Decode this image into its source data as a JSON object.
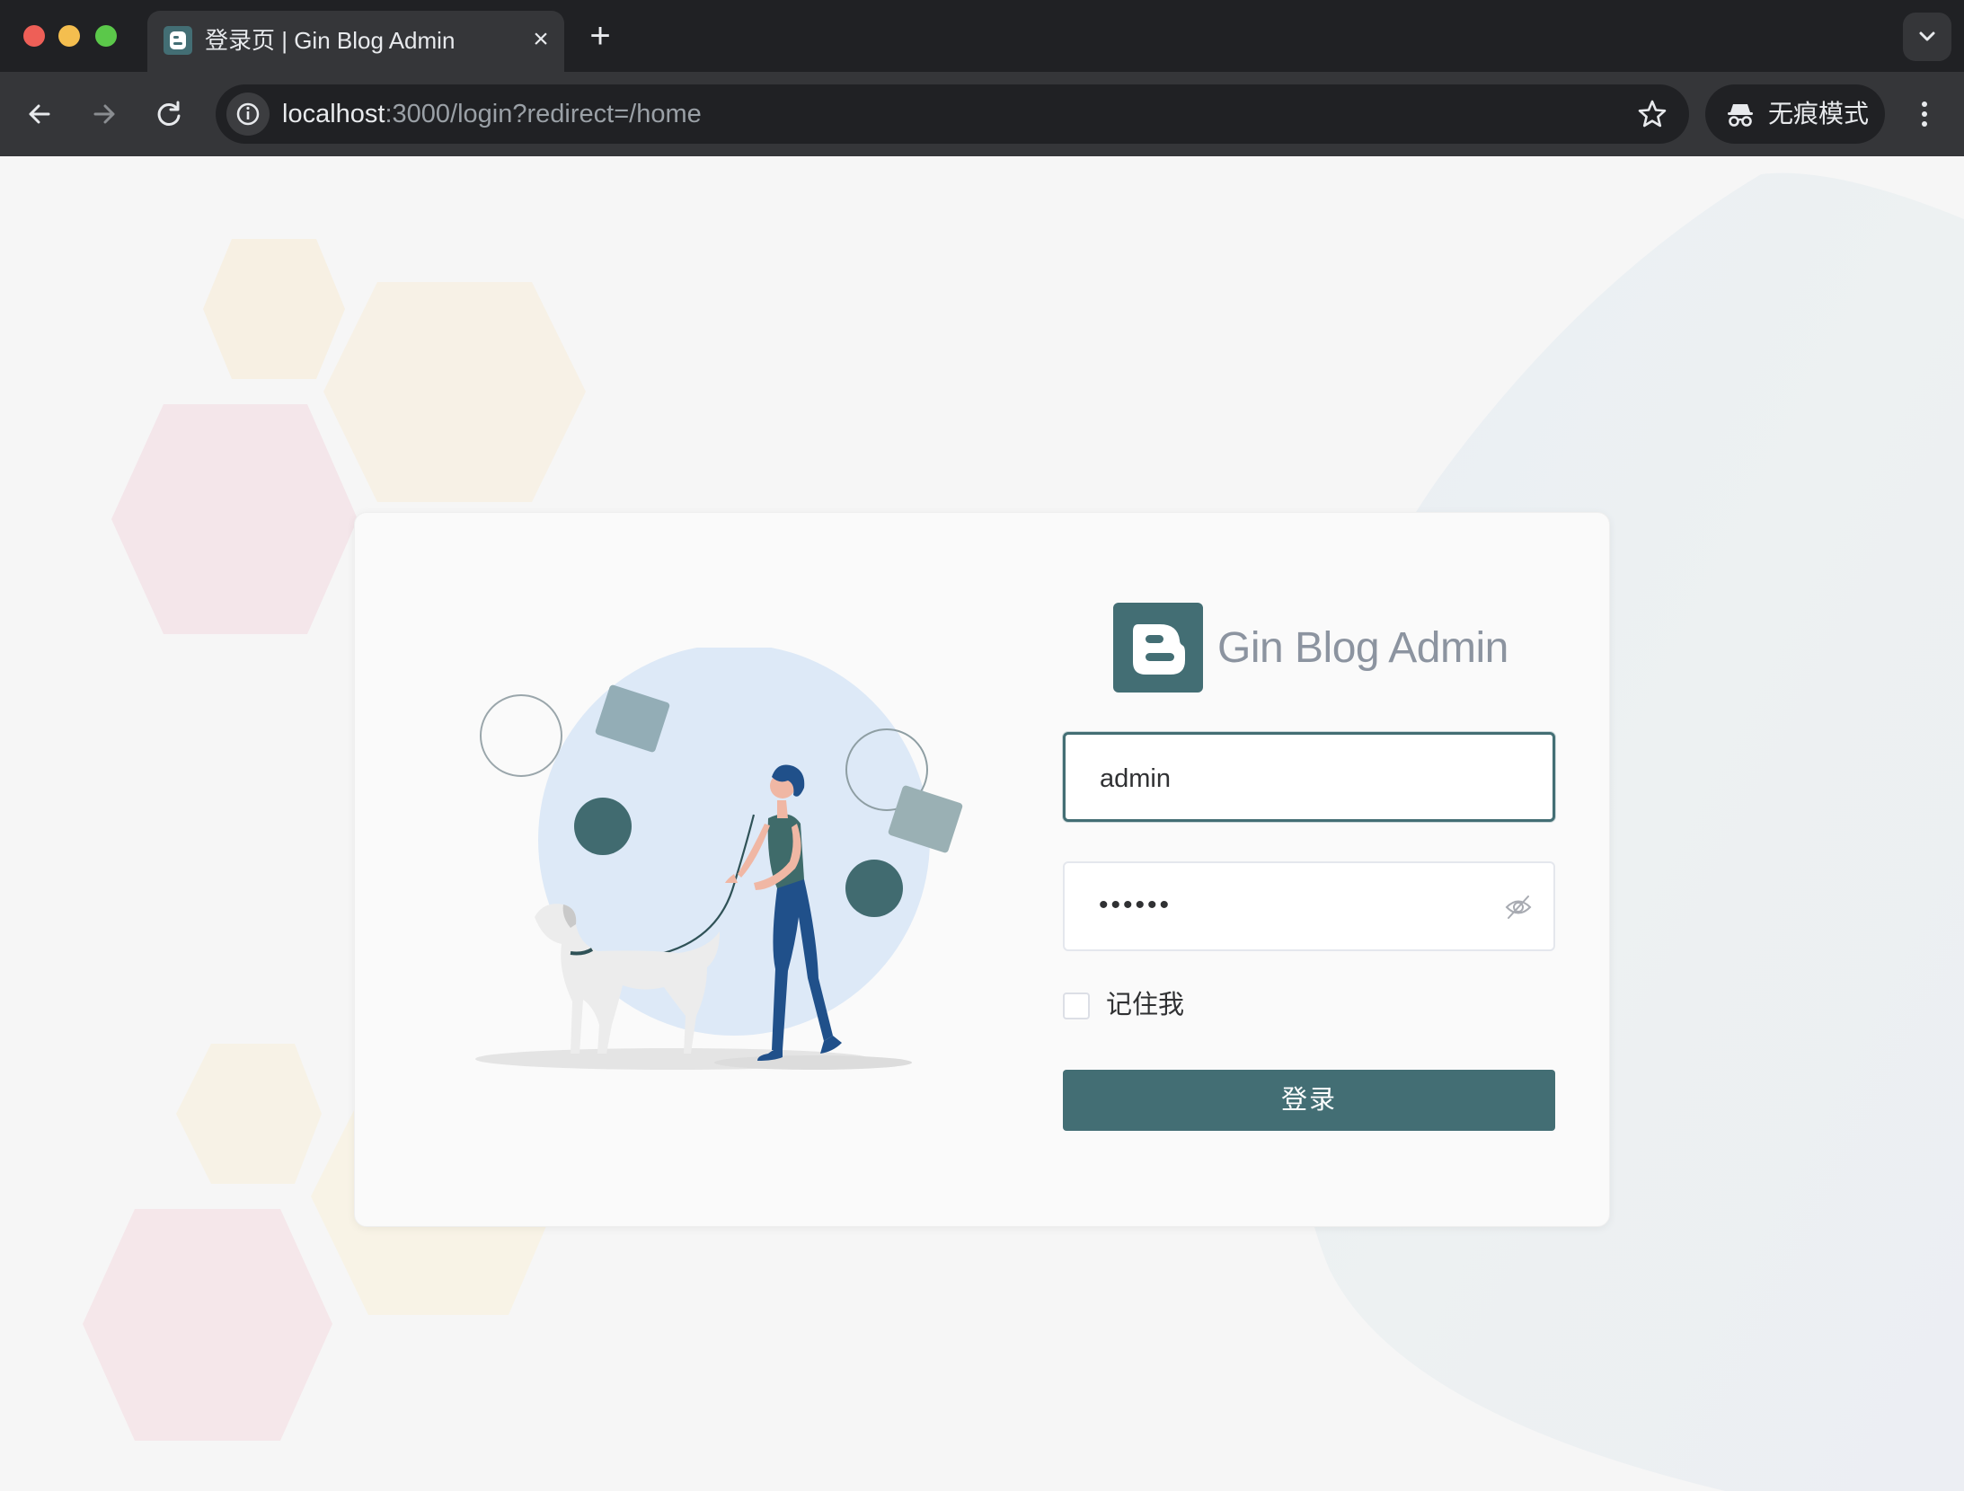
{
  "browser": {
    "tab_title": "登录页 | Gin Blog Admin",
    "tab_close": "×",
    "new_tab": "+",
    "url_host": "localhost",
    "url_rest": ":3000/login?redirect=/home",
    "incognito_label": "无痕模式"
  },
  "login": {
    "brand_name": "Gin Blog Admin",
    "username_value": "admin",
    "password_value": "••••••",
    "remember_label": "记住我",
    "submit_label": "登录"
  },
  "colors": {
    "accent": "#436e74",
    "background": "#f6f6f6",
    "card": "#fafafa"
  },
  "icons": [
    "gin-blog-logo-icon",
    "back-arrow-icon",
    "forward-arrow-icon",
    "reload-icon",
    "site-info-icon",
    "bookmark-star-icon",
    "incognito-icon",
    "more-vert-icon",
    "eye-off-icon"
  ]
}
